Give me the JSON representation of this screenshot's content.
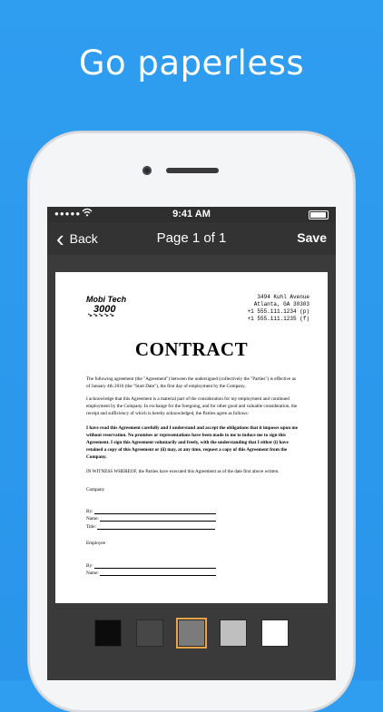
{
  "headline": "Go paperless",
  "status": {
    "signal": "●●●●●",
    "wifi": "wifi-icon",
    "time": "9:41 AM"
  },
  "nav": {
    "back": "Back",
    "title": "Page 1 of 1",
    "save": "Save"
  },
  "document": {
    "logo_text": [
      "Mobi Tech",
      "3000"
    ],
    "address": [
      "3494 Kuhl Avenue",
      "Atlanta, GA 30303",
      "+1 555.111.1234 (p)",
      "+1 555.111.1235 (f)"
    ],
    "title": "CONTRACT",
    "paragraphs": [
      "The following agreement (the \"Agreement\") between the undersigned (collectively the \"Parties\") is effective as of January 4th 2016 (the \"Start Date\"), the first day of employment by the Company.",
      "I acknowledge that this Agreement is a material part of the consideration for my employment and continued employment by the Company. In exchange for the foregoing, and for other good and valuable consideration, the receipt and sufficiency of which is hereby acknowledged, the Parties agree as follows:",
      "I have read this Agreement carefully and I understand and accept the obligations that it imposes upon me without reservation. No promises or representations have been made to me to induce me to sign this Agreement. I sign this Agreement voluntarily and freely, with the understanding that I either (i) have retained a copy of this Agreement or (ii) may, at any time, request a copy of this Agreement from the Company.",
      "IN WITNESS WHEREOF, the Parties have executed this Agreement as of the date first above written."
    ],
    "company_label": "Company",
    "by_label": "By:",
    "name_label": "Name:",
    "title_label": "Title:",
    "employee_label": "Employee"
  },
  "swatches": [
    {
      "color": "#0c0c0c",
      "selected": false
    },
    {
      "color": "#474747",
      "selected": false
    },
    {
      "color": "#7b7b7b",
      "selected": true
    },
    {
      "color": "#bfbfbf",
      "selected": false
    },
    {
      "color": "#ffffff",
      "selected": false
    }
  ]
}
